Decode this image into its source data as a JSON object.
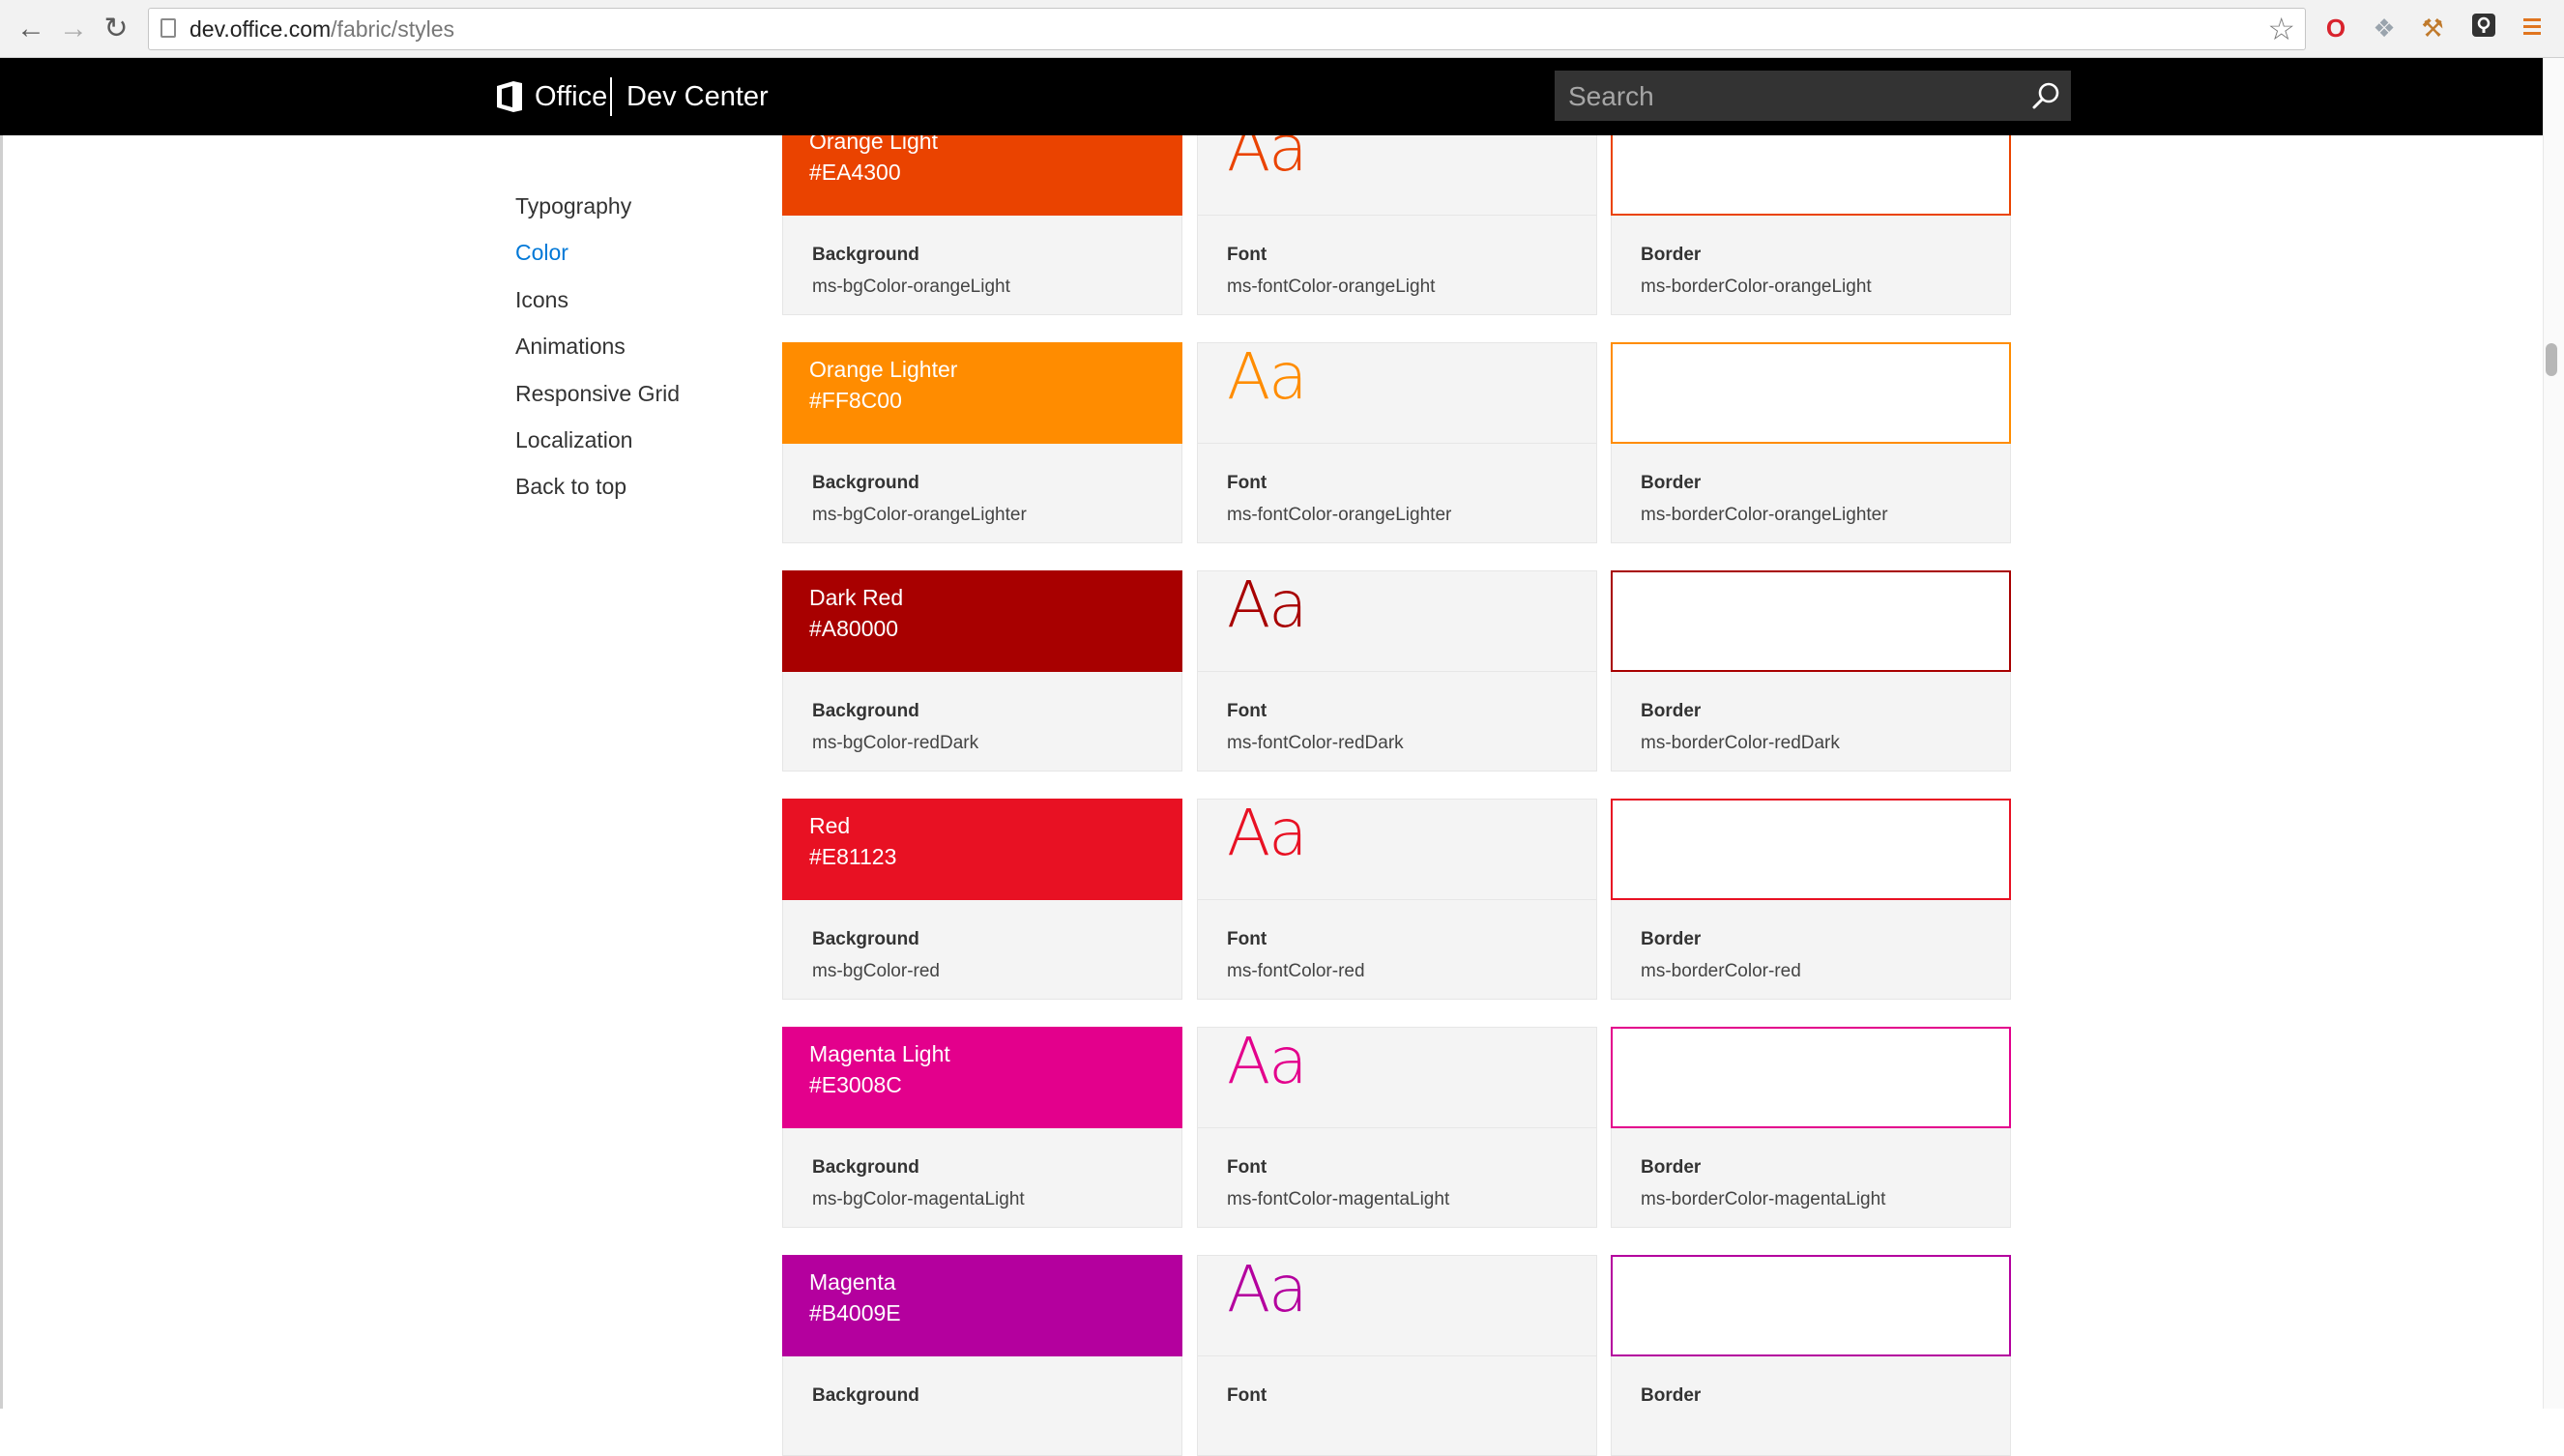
{
  "browser": {
    "url_host": "dev.office.com",
    "url_path": "/fabric/styles"
  },
  "header": {
    "brand": "Office",
    "subtitle": "Dev Center",
    "search_placeholder": "Search"
  },
  "leftnav": {
    "items": [
      {
        "label": "Typography",
        "active": false
      },
      {
        "label": "Color",
        "active": true
      },
      {
        "label": "Icons",
        "active": false
      },
      {
        "label": "Animations",
        "active": false
      },
      {
        "label": "Responsive Grid",
        "active": false
      },
      {
        "label": "Localization",
        "active": false
      },
      {
        "label": "Back to top",
        "active": false
      }
    ]
  },
  "swatches": [
    {
      "name": "Orange Light",
      "hex": "#EA4300",
      "key": "orangeLight"
    },
    {
      "name": "Orange Lighter",
      "hex": "#FF8C00",
      "key": "orangeLighter"
    },
    {
      "name": "Dark Red",
      "hex": "#A80000",
      "key": "redDark"
    },
    {
      "name": "Red",
      "hex": "#E81123",
      "key": "red"
    },
    {
      "name": "Magenta Light",
      "hex": "#E3008C",
      "key": "magentaLight"
    },
    {
      "name": "Magenta",
      "hex": "#B4009E",
      "key": "magenta"
    }
  ],
  "cards": [
    [
      {
        "label": "Background",
        "class": "ms-bgColor-orangeLight"
      },
      {
        "label": "Font",
        "class": "ms-fontColor-orangeLight",
        "sample": "Aa"
      },
      {
        "label": "Border",
        "class": "ms-borderColor-orangeLight"
      }
    ],
    [
      {
        "label": "Background",
        "class": "ms-bgColor-orangeLighter"
      },
      {
        "label": "Font",
        "class": "ms-fontColor-orangeLighter",
        "sample": "Aa"
      },
      {
        "label": "Border",
        "class": "ms-borderColor-orangeLighter"
      }
    ],
    [
      {
        "label": "Background",
        "class": "ms-bgColor-redDark"
      },
      {
        "label": "Font",
        "class": "ms-fontColor-redDark",
        "sample": "Aa"
      },
      {
        "label": "Border",
        "class": "ms-borderColor-redDark"
      }
    ],
    [
      {
        "label": "Background",
        "class": "ms-bgColor-red"
      },
      {
        "label": "Font",
        "class": "ms-fontColor-red",
        "sample": "Aa"
      },
      {
        "label": "Border",
        "class": "ms-borderColor-red"
      }
    ],
    [
      {
        "label": "Background",
        "class": "ms-bgColor-magentaLight"
      },
      {
        "label": "Font",
        "class": "ms-fontColor-magentaLight",
        "sample": "Aa"
      },
      {
        "label": "Border",
        "class": "ms-borderColor-magentaLight"
      }
    ],
    [
      {
        "label": "Background",
        "class": ""
      },
      {
        "label": "Font",
        "class": "",
        "sample": "Aa"
      },
      {
        "label": "Border",
        "class": ""
      }
    ]
  ],
  "colors": {
    "header_bg": "#000000",
    "nav_active": "#0078d7",
    "card_bg": "#f4f4f4"
  }
}
